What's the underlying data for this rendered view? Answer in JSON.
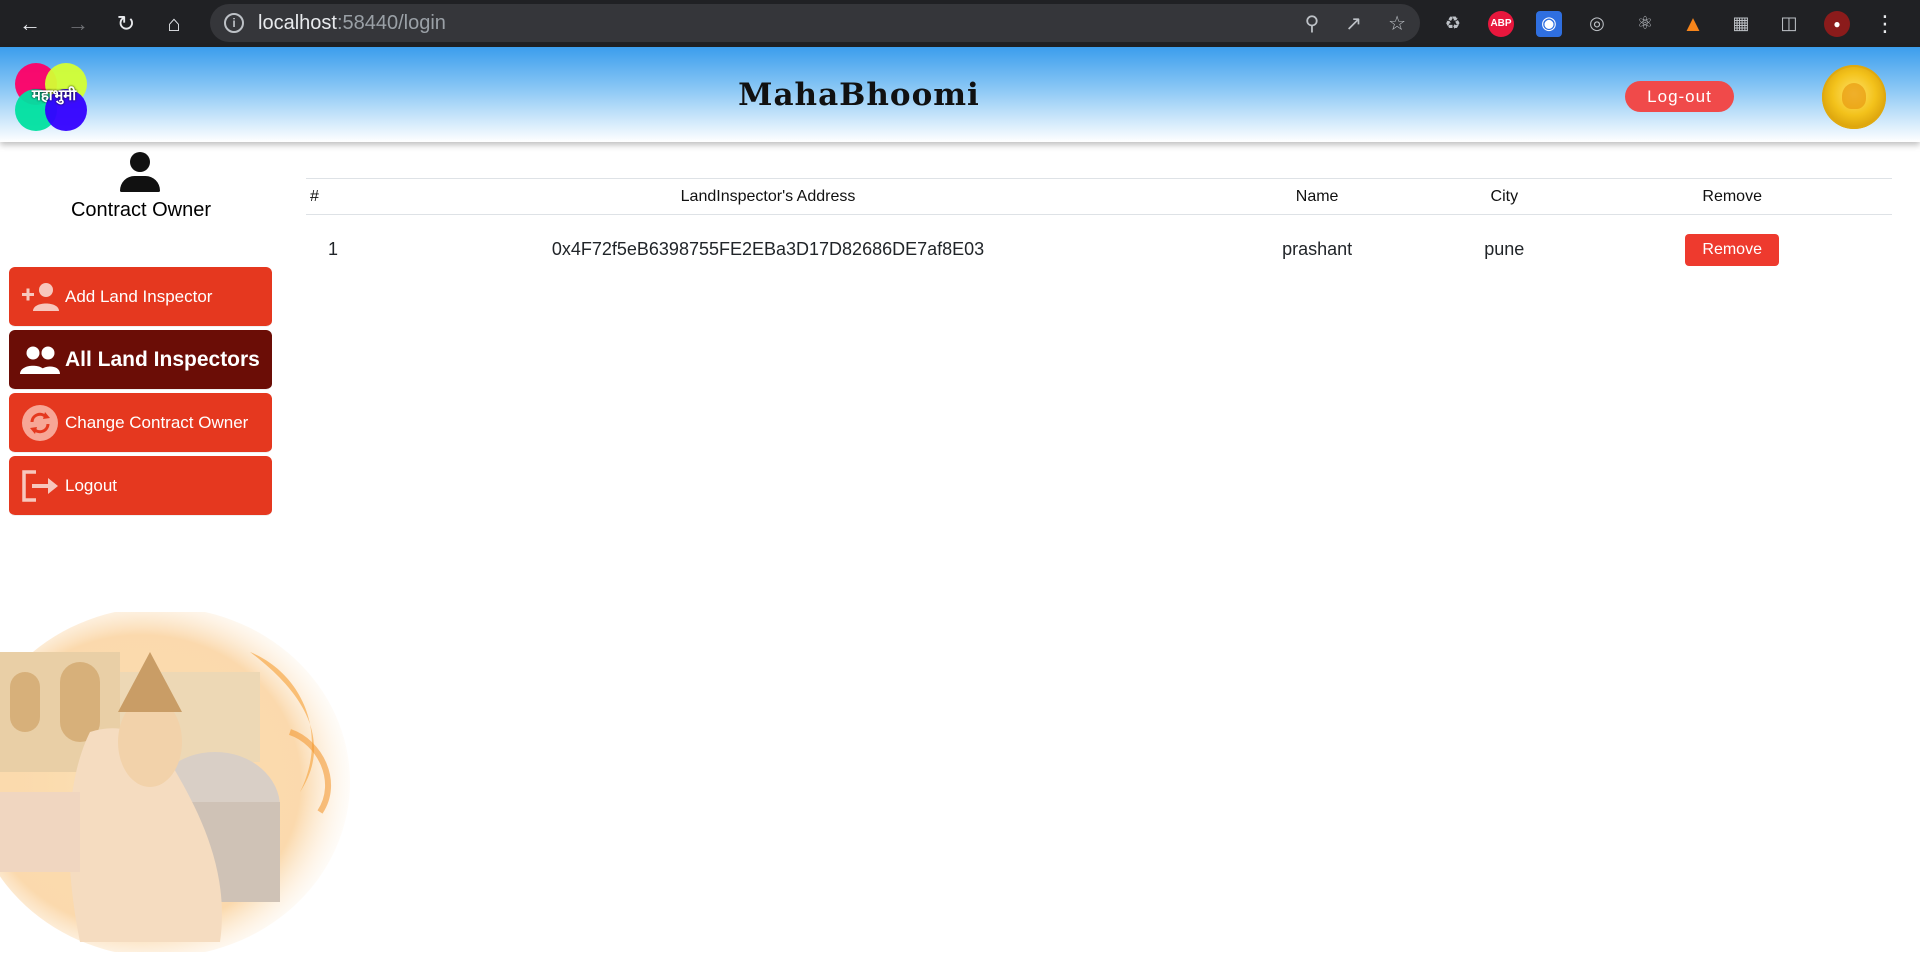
{
  "browser": {
    "url_host": "localhost",
    "url_rest": ":58440/login",
    "icons": [
      "back-icon",
      "forward-icon",
      "reload-icon",
      "home-icon",
      "info-icon",
      "zoom-icon",
      "share-icon",
      "star-icon"
    ],
    "extensions": {
      "abp_label": "ABP"
    }
  },
  "header": {
    "logo_text": "महाभुमी",
    "title": "MahaBhoomi",
    "logout_label": "Log-out"
  },
  "sidebar": {
    "role": "Contract Owner",
    "items": [
      {
        "label": "Add Land Inspector",
        "icon": "add-user-icon",
        "active": false
      },
      {
        "label": "All Land Inspectors",
        "icon": "users-icon",
        "active": true
      },
      {
        "label": "Change Contract Owner",
        "icon": "sync-icon",
        "active": false
      },
      {
        "label": "Logout",
        "icon": "logout-icon",
        "active": false
      }
    ]
  },
  "table": {
    "headers": [
      "#",
      "LandInspector's Address",
      "Name",
      "City",
      "Remove"
    ],
    "rows": [
      {
        "num": "1",
        "address": "0x4F72f5eB6398755FE2EBa3D17D82686DE7af8E03",
        "name": "prashant",
        "city": "pune",
        "action": "Remove"
      }
    ]
  },
  "colors": {
    "menu_red": "#e5381f",
    "menu_active": "#6b0d06",
    "remove_button": "#ee3a2e",
    "logout_pill": "#f04a4a"
  }
}
